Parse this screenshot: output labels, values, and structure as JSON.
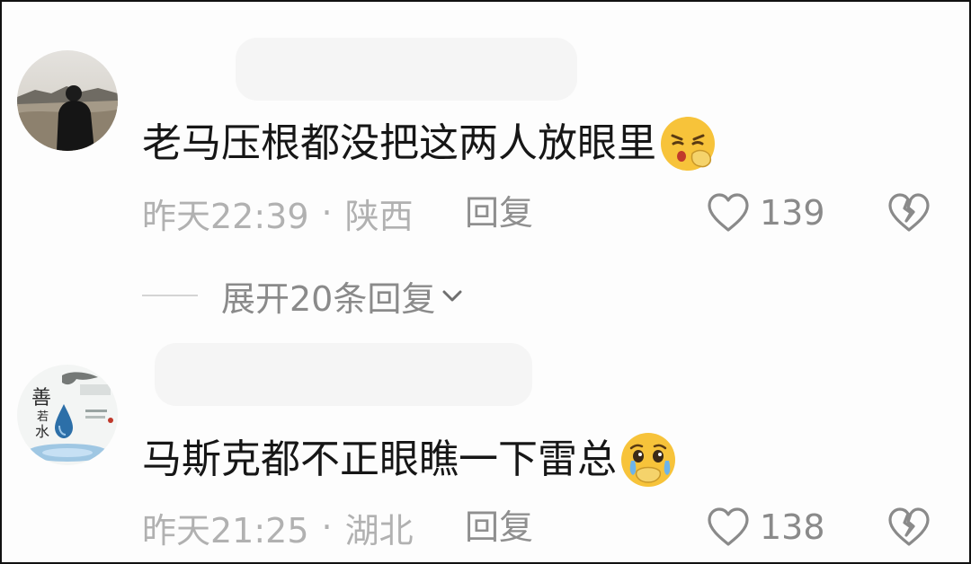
{
  "comments": [
    {
      "text": "老马压根都没把这两人放眼里",
      "emoji": "sneezing-face-emoji",
      "time": "昨天22:39",
      "separator": "·",
      "location": "陕西",
      "reply_label": "回复",
      "like_count": "139",
      "expand_label": "展开20条回复"
    },
    {
      "text": "马斯克都不正眼瞧一下雷总",
      "emoji": "crying-covering-mouth-emoji",
      "time": "昨天21:25",
      "separator": "·",
      "location": "湖北",
      "reply_label": "回复",
      "like_count": "138"
    }
  ],
  "icons": {
    "like": "heart-outline-icon",
    "dislike": "broken-heart-icon",
    "expand": "chevron-down-icon"
  },
  "colors": {
    "text_primary": "#161616",
    "text_meta": "#b1b1b1",
    "text_action": "#8a8a8a",
    "border": "#111111",
    "emoji_yellow": "#f7c33a"
  },
  "avatar_2_text": "善若水"
}
